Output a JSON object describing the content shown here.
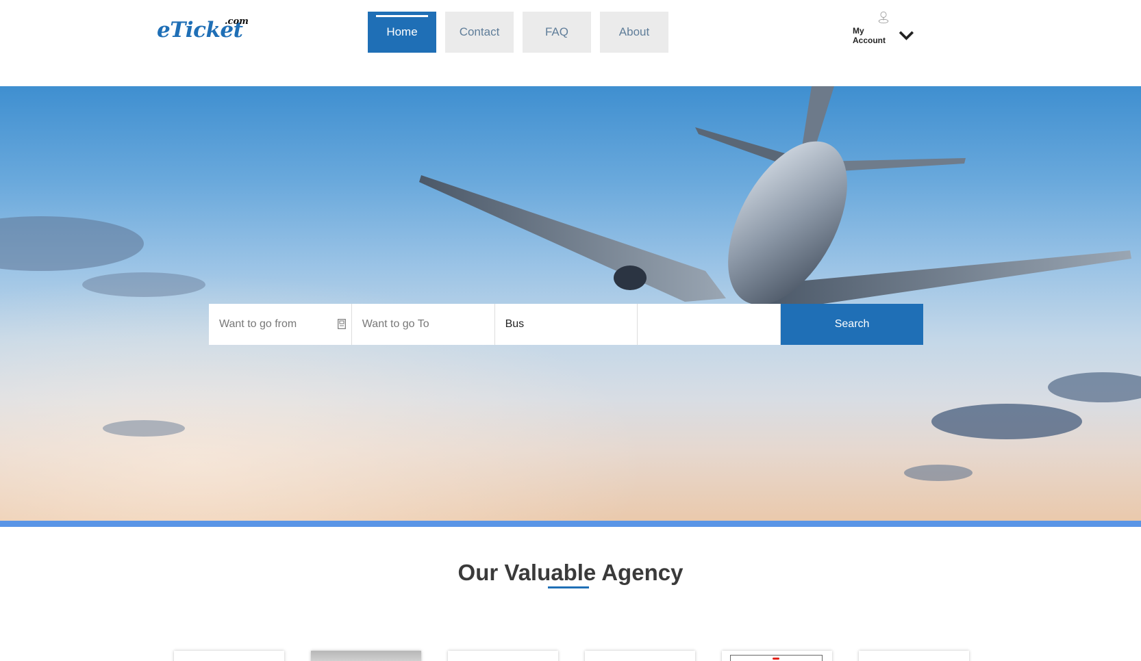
{
  "header": {
    "logo_main": "eTicket",
    "logo_tld": ".com",
    "nav": [
      {
        "label": "Home",
        "active": true
      },
      {
        "label": "Contact",
        "active": false
      },
      {
        "label": "FAQ",
        "active": false
      },
      {
        "label": "About",
        "active": false
      }
    ],
    "account_label": "My Account"
  },
  "search": {
    "from_placeholder": "Want to go from",
    "to_placeholder": "Want to go To",
    "type_value": "Bus",
    "button_label": "Search"
  },
  "agency": {
    "title": "Our Valuable Agency"
  },
  "colors": {
    "brand": "#1f6fb6",
    "hero_bar": "#5a95e6",
    "nav_inactive_bg": "#ebebeb"
  }
}
